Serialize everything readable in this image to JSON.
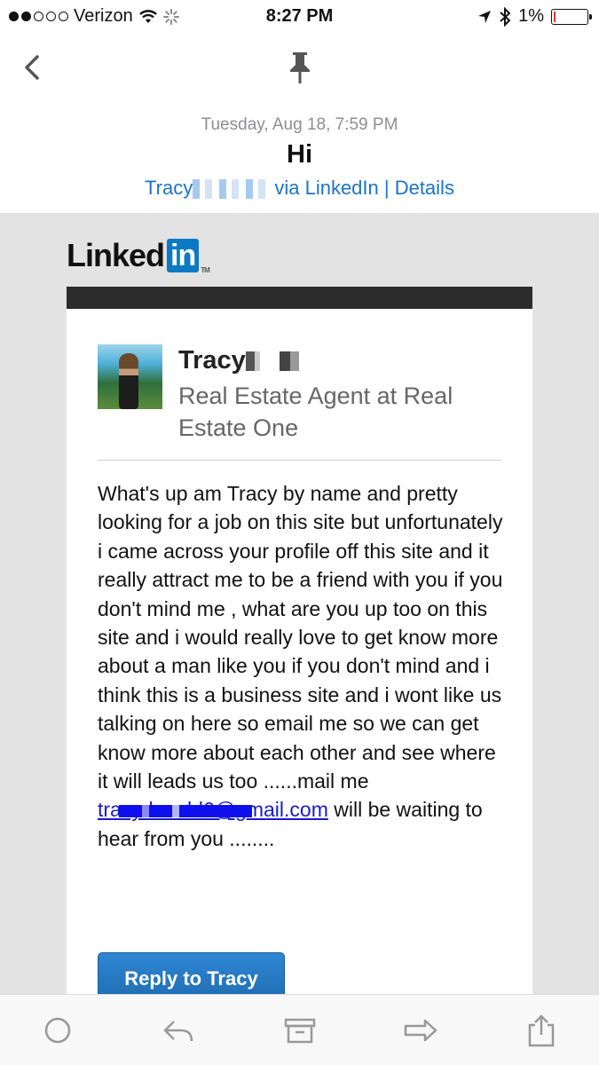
{
  "status_bar": {
    "carrier": "Verizon",
    "time": "8:27 PM",
    "battery": "1%",
    "battery_level": 0.01
  },
  "nav": {
    "back_icon": "chevron-left-icon",
    "pin_icon": "pin-icon"
  },
  "header": {
    "date": "Tuesday, Aug 18, 7:59 PM",
    "subject": "Hi",
    "from_name": "Tracy",
    "from_suffix": "via LinkedIn | Details"
  },
  "email": {
    "logo_text": "Linked",
    "logo_in": "in",
    "sender_name": "Tracy",
    "sender_headline": "Real Estate Agent at Real Estate One",
    "message_before_link": "What's up am Tracy by name and pretty looking for a job on this site but unfortunately i came across your profile off this site and it really attract me to be a friend with you if you don't mind me , what are you up too on this site and i would really love to get know more about a man like you if you don't mind and i think this is a business site and i wont like us talking on here so email me so we can get know more about each other and see where it will leads us too ......mail me ",
    "message_link": "tracydonald6@gmail.com",
    "message_after_link": " will be waiting to hear from you ........",
    "reply_button": "Reply to Tracy"
  },
  "toolbar": {
    "icons": [
      "circle-icon",
      "reply-icon",
      "archive-icon",
      "forward-icon",
      "share-icon"
    ]
  },
  "colors": {
    "link_blue": "#1a73c8",
    "linkedin_blue": "#0a7ac2",
    "reply_button": "#2779c0",
    "background_gray": "#e3e3e3"
  }
}
